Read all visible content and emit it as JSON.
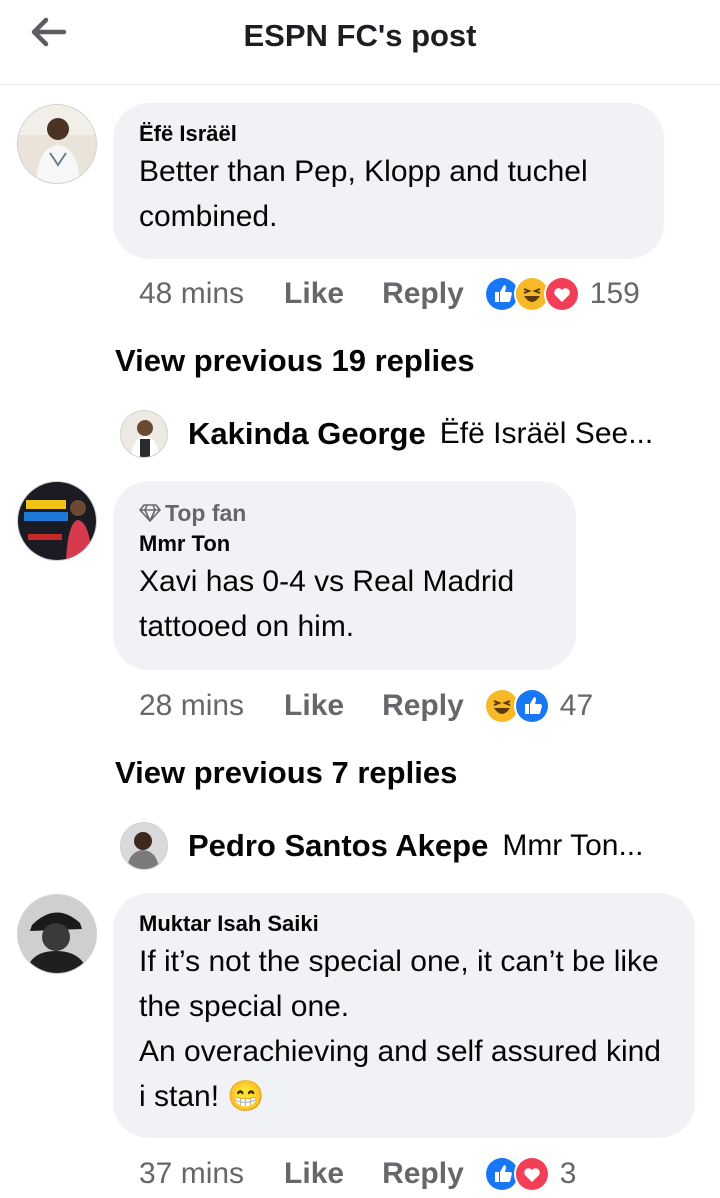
{
  "header": {
    "title": "ESPN FC's post",
    "back_icon": "arrow-left-icon"
  },
  "colors": {
    "like_blue": "#1877f2",
    "love_red": "#f33e58",
    "haha_yellow": "#f7b928",
    "bubble_bg": "#f0f2f5",
    "meta_gray": "#65676b"
  },
  "comments": [
    {
      "author": "Ëfë Isräël",
      "text": "Better than Pep, Klopp and tuchel combined.",
      "time": "48 mins",
      "like_label": "Like",
      "reply_label": "Reply",
      "reactions": [
        "like",
        "haha",
        "love"
      ],
      "reaction_count": "159",
      "view_previous": "View previous 19 replies",
      "latest_reply": {
        "author": "Kakinda George",
        "text": "Ëfë Isräël See..."
      }
    },
    {
      "badge": "Top fan",
      "author": "Mmr Ton",
      "text": "Xavi has 0-4 vs Real Madrid tattooed on him.",
      "time": "28 mins",
      "like_label": "Like",
      "reply_label": "Reply",
      "reactions": [
        "haha",
        "like"
      ],
      "reaction_count": "47",
      "view_previous": "View previous 7 replies",
      "latest_reply": {
        "author": "Pedro Santos Akepe",
        "text": "Mmr Ton..."
      }
    },
    {
      "author": "Muktar Isah Saiki",
      "text": "If it’s not the special one, it can’t be like the special one.\nAn overachieving and self assured kind i stan! 😁",
      "time": "37 mins",
      "like_label": "Like",
      "reply_label": "Reply",
      "reactions": [
        "like",
        "love"
      ],
      "reaction_count": "3"
    }
  ]
}
